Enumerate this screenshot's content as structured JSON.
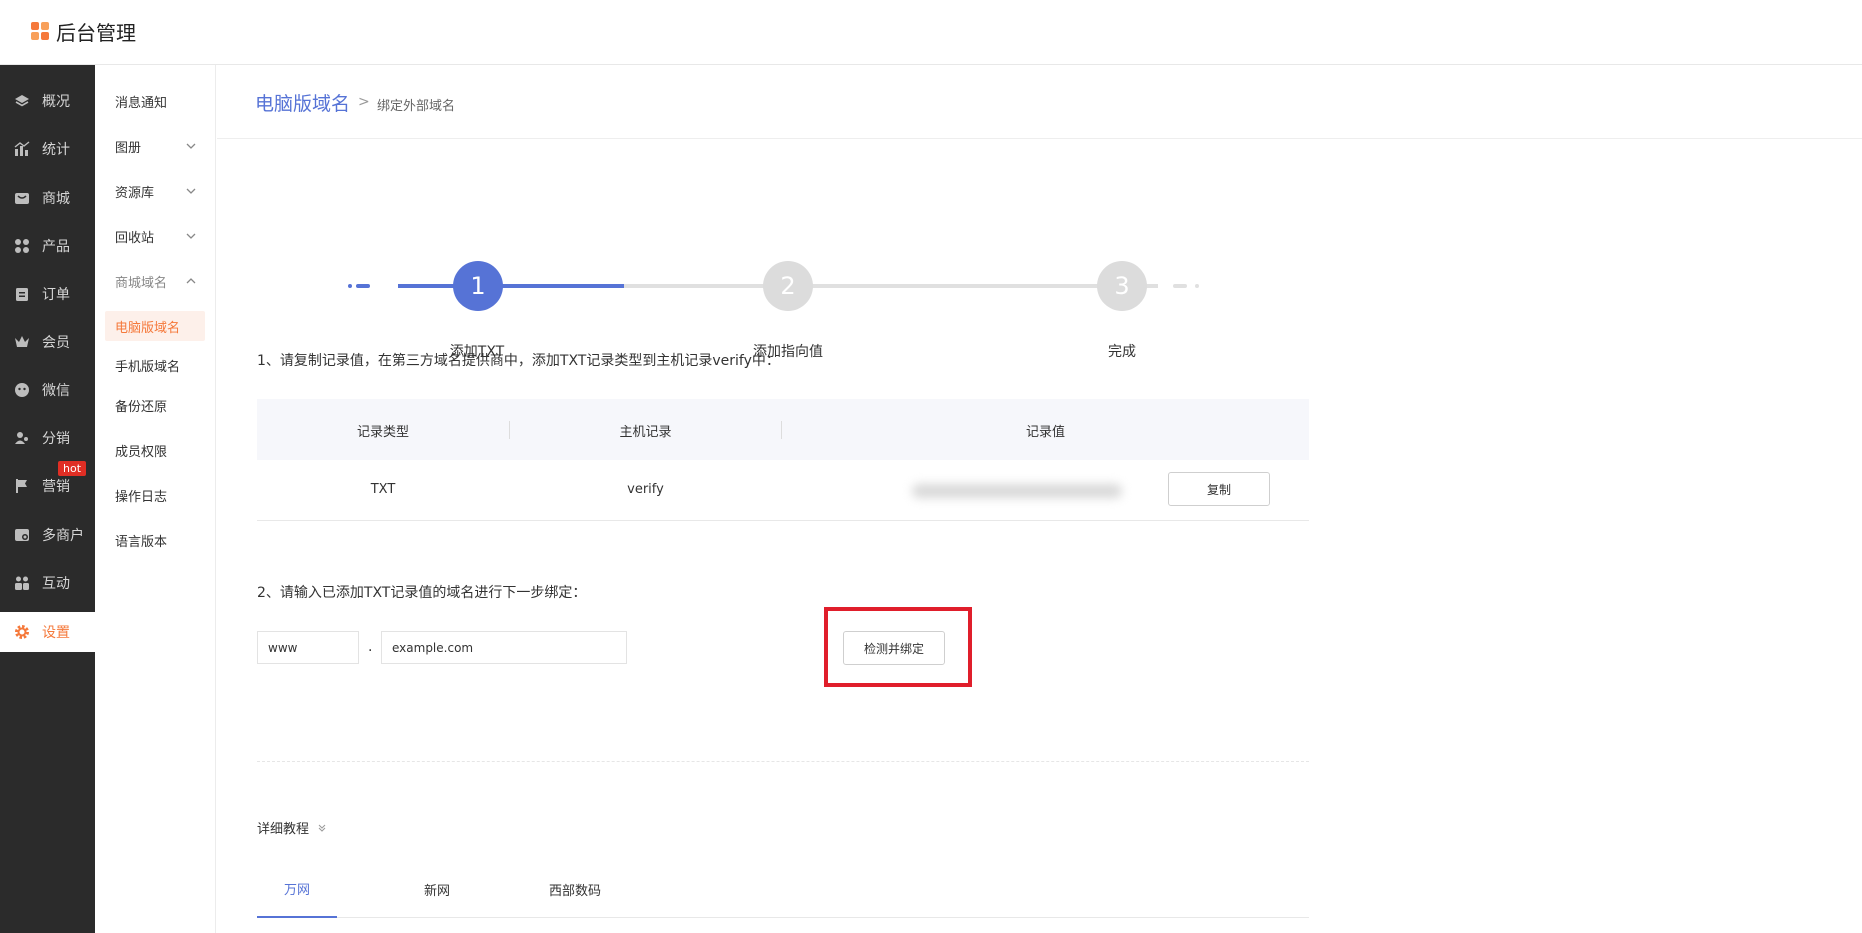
{
  "app": {
    "title": "后台管理",
    "brand_color": "#f5793b",
    "accent_color": "#5673d6"
  },
  "leftnav": {
    "items": [
      {
        "label": "概况",
        "icon": "layers-icon"
      },
      {
        "label": "统计",
        "icon": "chart-icon"
      },
      {
        "label": "商城",
        "icon": "shop-icon"
      },
      {
        "label": "产品",
        "icon": "grid-icon"
      },
      {
        "label": "订单",
        "icon": "clipboard-icon"
      },
      {
        "label": "会员",
        "icon": "crown-icon"
      },
      {
        "label": "微信",
        "icon": "wechat-icon"
      },
      {
        "label": "分销",
        "icon": "users-icon"
      },
      {
        "label": "营销",
        "icon": "flag-icon"
      },
      {
        "label": "多商户",
        "icon": "store-icon"
      },
      {
        "label": "互动",
        "icon": "people-icon"
      },
      {
        "label": "设置",
        "icon": "gear-icon"
      }
    ],
    "hot_badge": "hot"
  },
  "subnav": {
    "items": [
      {
        "label": "消息通知"
      },
      {
        "label": "图册"
      },
      {
        "label": "资源库"
      },
      {
        "label": "回收站"
      },
      {
        "label": "商城域名"
      },
      {
        "label": "电脑版域名"
      },
      {
        "label": "手机版域名"
      },
      {
        "label": "备份还原"
      },
      {
        "label": "成员权限"
      },
      {
        "label": "操作日志"
      },
      {
        "label": "语言版本"
      }
    ]
  },
  "breadcrumb": {
    "main": "电脑版域名",
    "sep": ">",
    "sub": "绑定外部域名"
  },
  "steps": [
    {
      "num": "1",
      "label": "添加TXT"
    },
    {
      "num": "2",
      "label": "添加指向值"
    },
    {
      "num": "3",
      "label": "完成"
    }
  ],
  "section1": {
    "instruction": "1、请复制记录值，在第三方域名提供商中，添加TXT记录类型到主机记录verify中：",
    "columns": [
      "记录类型",
      "主机记录",
      "记录值"
    ],
    "row": {
      "type": "TXT",
      "host": "verify"
    },
    "copy_label": "复制"
  },
  "section2": {
    "instruction": "2、请输入已添加TXT记录值的域名进行下一步绑定：",
    "prefix_value": "www",
    "dot": ".",
    "domain_value": "example.com",
    "check_label": "检测并绑定"
  },
  "tutorial": {
    "title": "详细教程",
    "tabs": [
      "万网",
      "新网",
      "西部数码"
    ]
  }
}
